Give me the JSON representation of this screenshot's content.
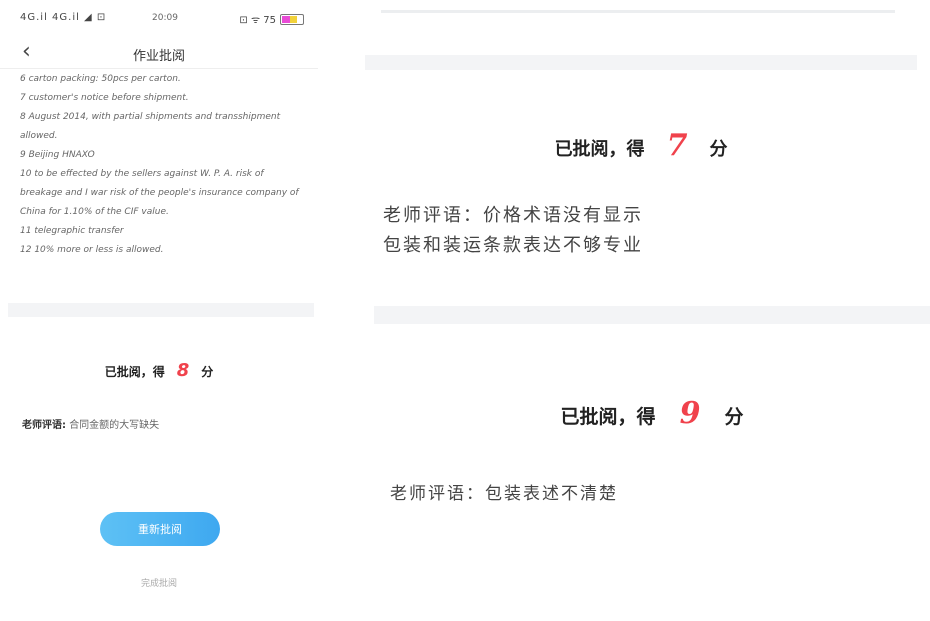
{
  "phone": {
    "status": {
      "signal": "4G.il 4G.il ◢ ⊡",
      "time": "20:09",
      "icons": "⊡ ᯤ 75",
      "battery_level": 0.75
    },
    "nav": {
      "back_icon": "chevron-left-icon",
      "title": "作业批阅"
    },
    "answers": [
      "6  carton packing: 50pcs per carton.",
      "7  customer's notice before shipment.",
      "8  August 2014, with partial shipments and transshipment allowed.",
      "9  Beijing HNAXO",
      "10  to be effected by the sellers against W. P. A. risk of breakage and I war risk of the people's insurance company of China for 1.10% of the CIF value.",
      "11  telegraphic transfer",
      "12  10% more or less is allowed."
    ],
    "result": {
      "prefix": "已批阅，得",
      "score": "8",
      "suffix": "分"
    },
    "comment": {
      "label": "老师评语:",
      "text": "合同金额的大写缺失"
    },
    "regrade_button": "重新批阅",
    "finish_link": "完成批阅"
  },
  "panel2": {
    "result": {
      "prefix": "已批阅，得",
      "score": "7",
      "suffix": "分"
    },
    "comment_line1": "老师评语：价格术语没有显示",
    "comment_line2": "包装和装运条款表达不够专业"
  },
  "panel3": {
    "result": {
      "prefix": "已批阅，得",
      "score": "9",
      "suffix": "分"
    },
    "comment_line1": "老师评语：包装表述不清楚"
  },
  "colors": {
    "score": "#f0424c",
    "button_start": "#5ec1f5",
    "button_end": "#3ea8f0",
    "band": "#f3f4f6"
  }
}
